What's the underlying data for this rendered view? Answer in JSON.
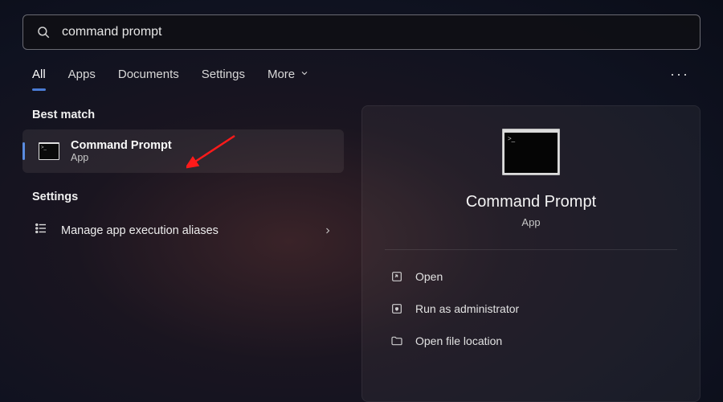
{
  "search": {
    "value": "command prompt"
  },
  "tabs": {
    "items": [
      {
        "label": "All",
        "active": true
      },
      {
        "label": "Apps",
        "active": false
      },
      {
        "label": "Documents",
        "active": false
      },
      {
        "label": "Settings",
        "active": false
      },
      {
        "label": "More",
        "active": false,
        "chevron": true
      }
    ]
  },
  "sections": {
    "best_match": "Best match",
    "settings": "Settings"
  },
  "best_match_result": {
    "title": "Command Prompt",
    "subtitle": "App"
  },
  "settings_result": {
    "title": "Manage app execution aliases"
  },
  "preview": {
    "title": "Command Prompt",
    "subtitle": "App"
  },
  "actions": [
    {
      "label": "Open"
    },
    {
      "label": "Run as administrator"
    },
    {
      "label": "Open file location"
    }
  ],
  "colors": {
    "accent": "#4a7bd4",
    "arrow": "#ff1a1a"
  }
}
